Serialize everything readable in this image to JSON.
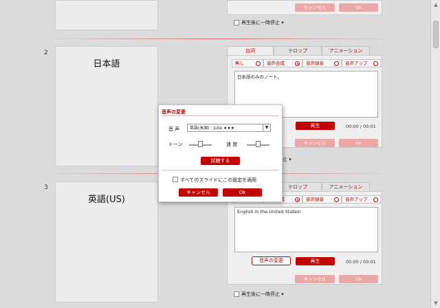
{
  "slides": [
    {
      "number": "",
      "title": ""
    },
    {
      "number": "2",
      "title": "日本語"
    },
    {
      "number": "3",
      "title": "英語(US)"
    }
  ],
  "panel_tabs": [
    "台詞",
    "テロップ",
    "アニメーション"
  ],
  "voice_modes": [
    "無し",
    "音声合成",
    "音声録音",
    "音声アップ"
  ],
  "panel2": {
    "text": "日本語のみのノート。",
    "play_label": "再生",
    "time": "00:00 / 00:01",
    "cancel_label": "キャンセル",
    "ok_label": "Ok"
  },
  "panel3": {
    "text": "English in the United States!",
    "change_voice_label": "音声の変更",
    "play_label": "再生",
    "time": "00:00 / 00:01",
    "cancel_label": "キャンセル",
    "ok_label": "Ok",
    "pause_label": "再生後に一時停止"
  },
  "panel1": {
    "cancel_label": "キャンセル",
    "ok_label": "Ok",
    "pause_label": "再生後に一時停止"
  },
  "panel2_pause_label": "止",
  "dialog": {
    "title": "音声の変更",
    "voice_label": "音 声",
    "voice_value": "英語(米国) : Julie ★★★",
    "tone_label": "トーン",
    "speed_label": "速 度",
    "tone_level": 0.5,
    "speed_level": 0.5,
    "try_label": "試聴する",
    "apply_all_label": "すべてのスライドにこの設定を適用",
    "cancel_label": "キャンセル",
    "ok_label": "Ok"
  },
  "colors": {
    "accent": "#c10000",
    "accent_disabled": "#eba7a7"
  }
}
